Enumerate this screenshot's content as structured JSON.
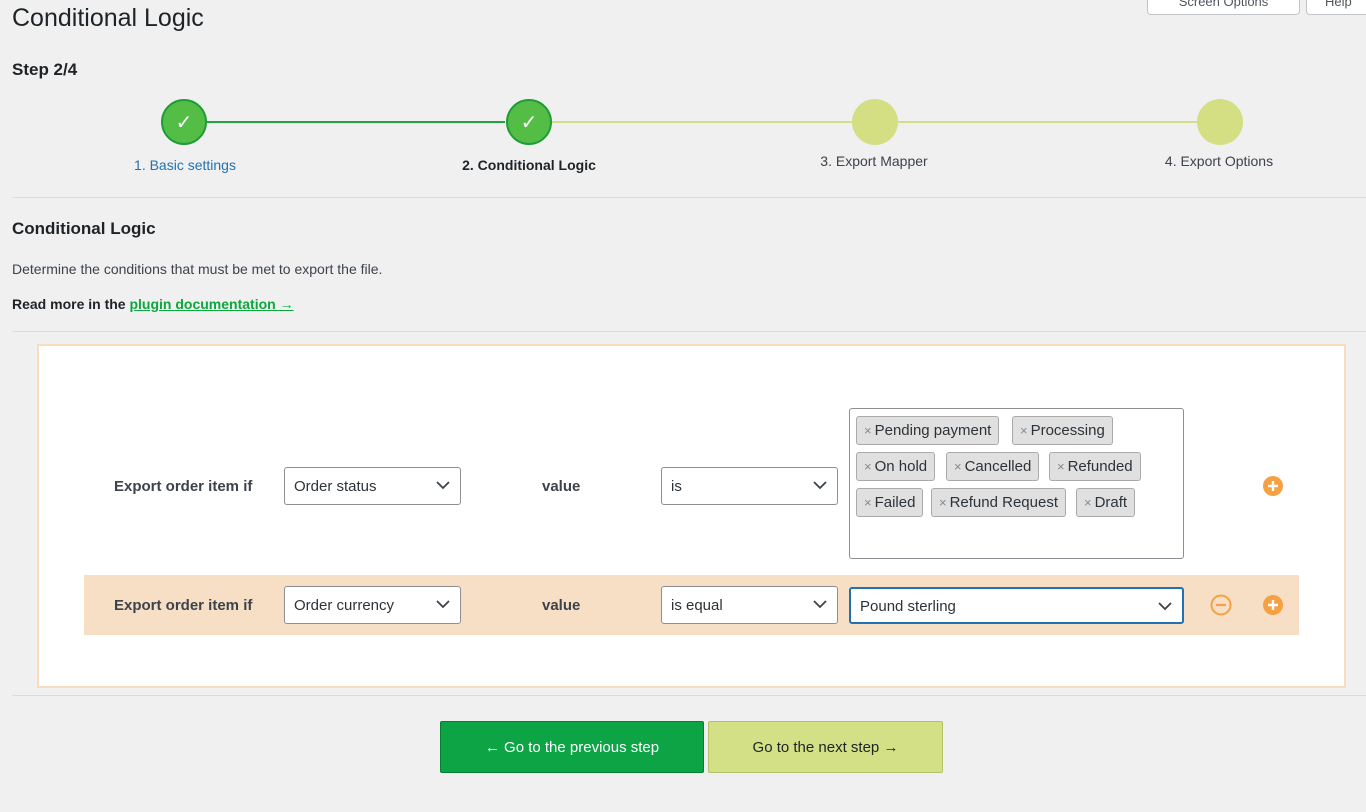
{
  "page": {
    "title": "Conditional Logic",
    "screen_options_label": "Screen Options",
    "help_label": "Help",
    "step_indicator": "Step 2/4"
  },
  "stepper": {
    "check_glyph": "✓",
    "steps": [
      {
        "label": "1. Basic settings",
        "state": "done"
      },
      {
        "label": "2. Conditional Logic",
        "state": "current"
      },
      {
        "label": "3. Export Mapper",
        "state": "todo"
      },
      {
        "label": "4. Export Options",
        "state": "todo"
      }
    ]
  },
  "section": {
    "title": "Conditional Logic",
    "description": "Determine the conditions that must be met to export the file.",
    "readmore_prefix": "Read more in the",
    "readmore_link": "plugin documentation →"
  },
  "rules": [
    {
      "label": "Export order item if",
      "field": "Order status",
      "value_label": "value",
      "operator": "is",
      "tags": [
        "Pending payment",
        "Processing",
        "On hold",
        "Cancelled",
        "Refunded",
        "Failed",
        "Refund Request",
        "Draft"
      ]
    },
    {
      "label": "Export order item if",
      "field": "Order currency",
      "value_label": "value",
      "operator": "is equal",
      "selected_value": "Pound sterling"
    }
  ],
  "tag_remove_glyph": "×",
  "icons": {
    "add": "plus-circle-icon",
    "remove": "minus-circle-icon",
    "accent": "#f5a042"
  },
  "nav": {
    "prev_label": "← Go to the previous step",
    "next_label": "Go to the next step →"
  }
}
